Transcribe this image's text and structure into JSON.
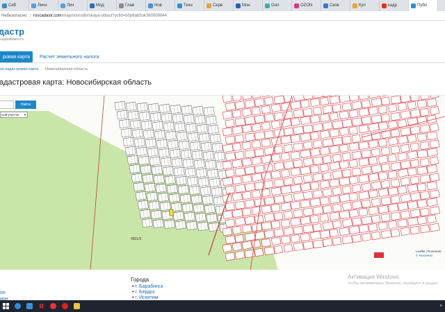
{
  "browser": {
    "tabs": [
      {
        "label": "Сиб",
        "color": "#3c8dbc"
      },
      {
        "label": "Личн",
        "color": "#5aa0d8"
      },
      {
        "label": "Лич",
        "color": "#5aa0d8"
      },
      {
        "label": "Мод",
        "color": "#2e6db4"
      },
      {
        "label": "Глав",
        "color": "#8a8a8a"
      },
      {
        "label": "Нов",
        "color": "#4a90d9"
      },
      {
        "label": "Техн",
        "color": "#2b8fd6"
      },
      {
        "label": "Серв",
        "color": "#e1a33a"
      },
      {
        "label": "Мон",
        "color": "#2b5fa8"
      },
      {
        "label": "Онл",
        "color": "#3bb0a8"
      },
      {
        "label": "OZON",
        "color": "#d8348a"
      },
      {
        "label": "Сков",
        "color": "#3a76d0"
      },
      {
        "label": "Куп",
        "color": "#f0a030"
      },
      {
        "label": "кадр",
        "color": "#e03020"
      },
      {
        "label": "Публ",
        "color": "#2b8fd6"
      }
    ],
    "active_tab": "Публ",
    "insecure_label": "Небезопасно",
    "url_host": "roscadastr.com",
    "url_path": "/map/novosibirskaya-oblast?yclid=b0p6ab5ok360508644"
  },
  "site": {
    "logo": "дастр",
    "logo_sub": "недвижимости",
    "tabs": [
      {
        "label": "ровая карта",
        "active": true
      },
      {
        "label": "Расчет земельного налога",
        "active": false
      }
    ],
    "breadcrumb": [
      "ая кадастровая карта",
      "Новосибирская область"
    ],
    "title": "адастровая карта: Новосибирская область"
  },
  "map": {
    "search_placeholder": "",
    "search_button": "Найти",
    "select_value": "ный участок",
    "parcel_label": "4501/3",
    "scale_text": "Leaflet | Rosreestr",
    "credit_text": "© Rosreestr",
    "colors": {
      "plots": "#d9323a",
      "green": "#c9e6a8",
      "roads": "#b8462f"
    }
  },
  "footer": {
    "left_links": [
      "он",
      "ион"
    ],
    "cities_heading": "Города",
    "cities": [
      "г. Барабинск",
      "г. Бердск",
      "г. Искитим"
    ],
    "watermark_title": "Активация Windows",
    "watermark_text": "Чтобы активировать Windows, перейдите в раздел"
  },
  "taskbar": {
    "icons": [
      "windows-start",
      "edge",
      "explorer",
      "yandex",
      "yandex-browser",
      "opera",
      "folder"
    ],
    "time_hint": ""
  }
}
